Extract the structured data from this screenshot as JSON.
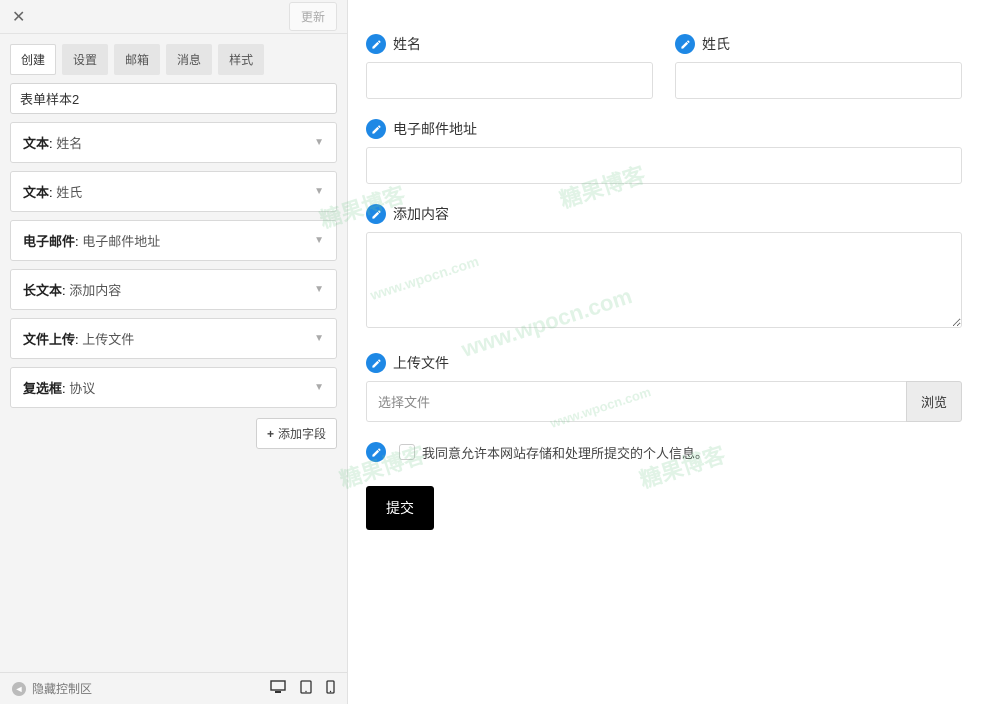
{
  "left": {
    "update_btn": "更新",
    "tabs": [
      "创建",
      "设置",
      "邮箱",
      "消息",
      "样式"
    ],
    "active_tab_index": 0,
    "form_name": "表单样本2",
    "fields": [
      {
        "type": "文本",
        "label": "姓名"
      },
      {
        "type": "文本",
        "label": "姓氏"
      },
      {
        "type": "电子邮件",
        "label": "电子邮件地址"
      },
      {
        "type": "长文本",
        "label": "添加内容"
      },
      {
        "type": "文件上传",
        "label": "上传文件"
      },
      {
        "type": "复选框",
        "label": "协议"
      }
    ],
    "add_field": "添加字段",
    "hide_control": "隐藏控制区"
  },
  "preview": {
    "first_name": "姓名",
    "last_name": "姓氏",
    "email": "电子邮件地址",
    "textarea": "添加内容",
    "upload": "上传文件",
    "file_placeholder": "选择文件",
    "browse": "浏览",
    "consent": "我同意允许本网站存储和处理所提交的个人信息。",
    "submit": "提交"
  },
  "watermarks": {
    "text1": "糖果博客",
    "text2": "www.wpocn.com"
  }
}
